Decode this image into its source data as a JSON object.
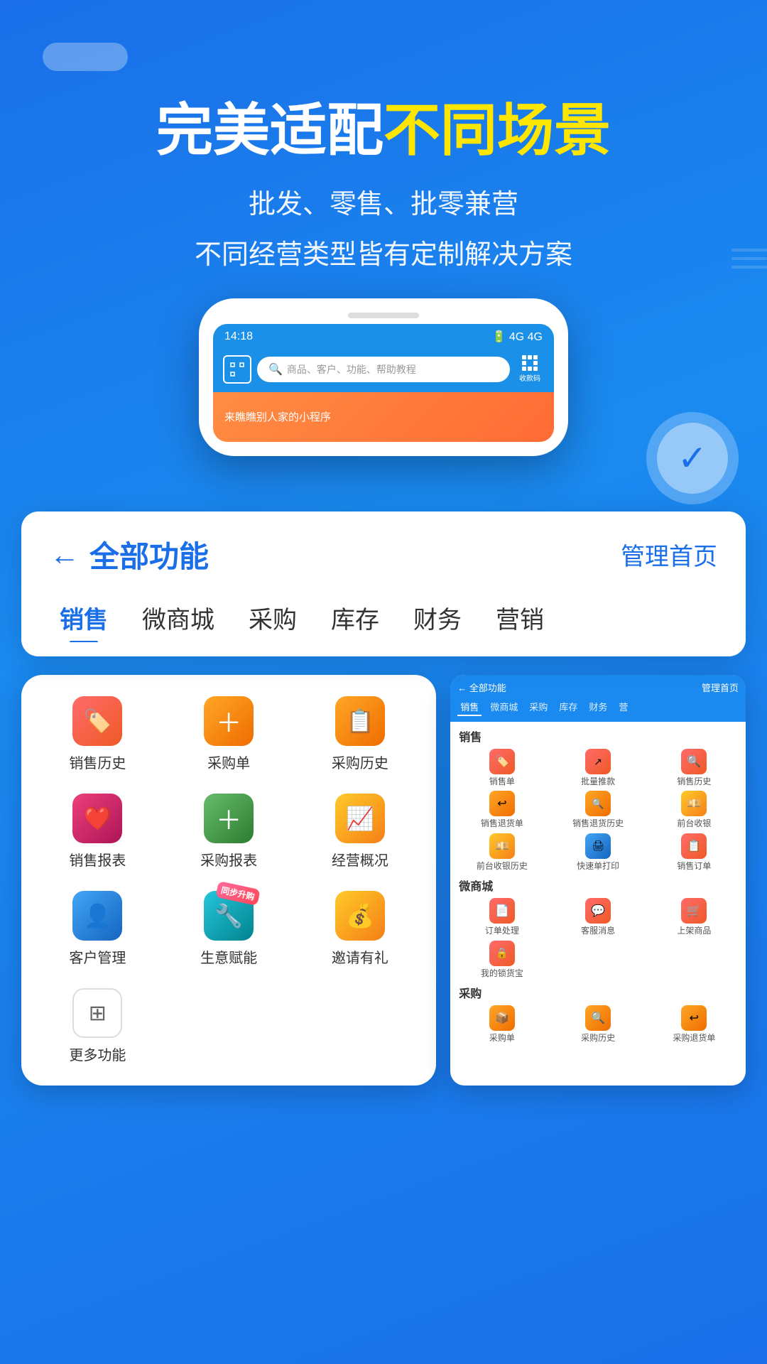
{
  "background": {
    "color": "#1a6fe8"
  },
  "hero": {
    "title_white": "完美适配",
    "title_yellow": "不同场景",
    "subtitle1": "批发、零售、批零兼营",
    "subtitle2": "不同经营类型皆有定制解决方案"
  },
  "phone_screen": {
    "time": "14:18",
    "search_placeholder": "商品、客户、功能、帮助教程",
    "banner_text": "来瞧瞧别人家的小程序"
  },
  "function_panel": {
    "back_label": "全部功能",
    "manage_label": "管理首页",
    "tabs": [
      {
        "label": "销售",
        "active": true
      },
      {
        "label": "微商城",
        "active": false
      },
      {
        "label": "采购",
        "active": false
      },
      {
        "label": "库存",
        "active": false
      },
      {
        "label": "财务",
        "active": false
      },
      {
        "label": "营销",
        "active": false
      }
    ]
  },
  "features": [
    {
      "label": "销售历史",
      "icon": "🏷️",
      "color_class": "icon-red"
    },
    {
      "label": "采购单",
      "icon": "➕",
      "color_class": "icon-orange"
    },
    {
      "label": "采购历史",
      "icon": "📋",
      "color_class": "icon-orange"
    },
    {
      "label": "销售报表",
      "icon": "❤️",
      "color_class": "icon-pink"
    },
    {
      "label": "采购报表",
      "icon": "➕",
      "color_class": "icon-green"
    },
    {
      "label": "经营概况",
      "icon": "📈",
      "color_class": "icon-gold"
    },
    {
      "label": "客户管理",
      "icon": "👤",
      "color_class": "icon-blue"
    },
    {
      "label": "生意赋能",
      "icon": "🔧",
      "color_class": "icon-teal",
      "badge": "同步升购"
    },
    {
      "label": "邀请有礼",
      "icon": "💰",
      "color_class": "icon-gold"
    },
    {
      "label": "更多功能",
      "icon": "⊞",
      "color_class": "icon-gray"
    }
  ],
  "mini_phone": {
    "back_label": "← 全部功能",
    "manage_label": "管理首页",
    "tabs": [
      "销售",
      "微商城",
      "采购",
      "库存",
      "财务",
      "营"
    ],
    "sections": [
      {
        "title": "销售",
        "items": [
          {
            "label": "销售单",
            "icon": "🏷️",
            "color": "icon-red"
          },
          {
            "label": "批量推款",
            "icon": "↗️",
            "color": "icon-red"
          },
          {
            "label": "销售历史",
            "icon": "🔍",
            "color": "icon-red"
          },
          {
            "label": "销售退货单",
            "icon": "↩️",
            "color": "icon-orange"
          },
          {
            "label": "销售退货历史",
            "icon": "🔍",
            "color": "icon-orange"
          },
          {
            "label": "前台收银",
            "icon": "💴",
            "color": "icon-orange"
          },
          {
            "label": "前台收银历史",
            "icon": "💴",
            "color": "icon-orange"
          },
          {
            "label": "快速单打印",
            "icon": "🖨️",
            "color": "icon-blue"
          },
          {
            "label": "销售订单",
            "icon": "📋",
            "color": "icon-red"
          }
        ]
      },
      {
        "title": "微商城",
        "items": [
          {
            "label": "订单处理",
            "icon": "📄",
            "color": "icon-red"
          },
          {
            "label": "客服消息",
            "icon": "💬",
            "color": "icon-red"
          },
          {
            "label": "上架商品",
            "icon": "🛒",
            "color": "icon-red"
          },
          {
            "label": "我的锁货宝",
            "icon": "🔒",
            "color": "icon-red"
          }
        ]
      },
      {
        "title": "采购",
        "items": [
          {
            "label": "采购单",
            "icon": "📦",
            "color": "icon-orange"
          },
          {
            "label": "采购历史",
            "icon": "🔍",
            "color": "icon-orange"
          },
          {
            "label": "采购退货单",
            "icon": "↩️",
            "color": "icon-orange"
          }
        ]
      }
    ]
  }
}
